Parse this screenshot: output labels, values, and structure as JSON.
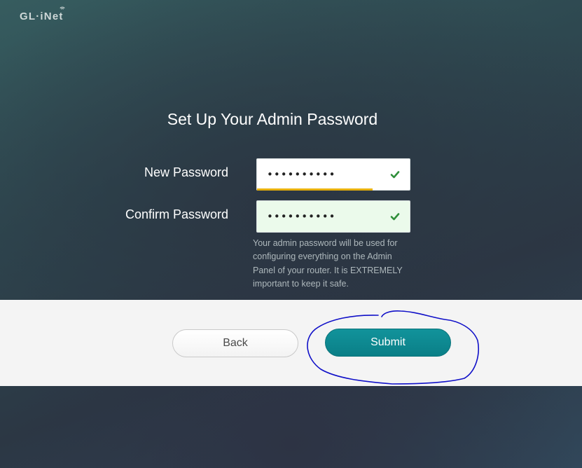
{
  "brand": {
    "logo_text": "GL·iNet"
  },
  "form": {
    "title": "Set Up Your Admin Password",
    "new_password": {
      "label": "New Password",
      "value": "••••••••••",
      "valid": true
    },
    "confirm_password": {
      "label": "Confirm Password",
      "value": "••••••••••",
      "valid": true
    },
    "hint": "Your admin password will be used for configuring everything on the Admin Panel of your router. It is EXTREMELY important to keep it safe."
  },
  "actions": {
    "back_label": "Back",
    "submit_label": "Submit"
  },
  "colors": {
    "accent": "#0a8a92",
    "strength_bar": "#e8b10b",
    "check": "#2f8f3a",
    "annotation": "#1010c8"
  },
  "icons": {
    "check": "check-icon",
    "wifi": "wifi-icon"
  }
}
